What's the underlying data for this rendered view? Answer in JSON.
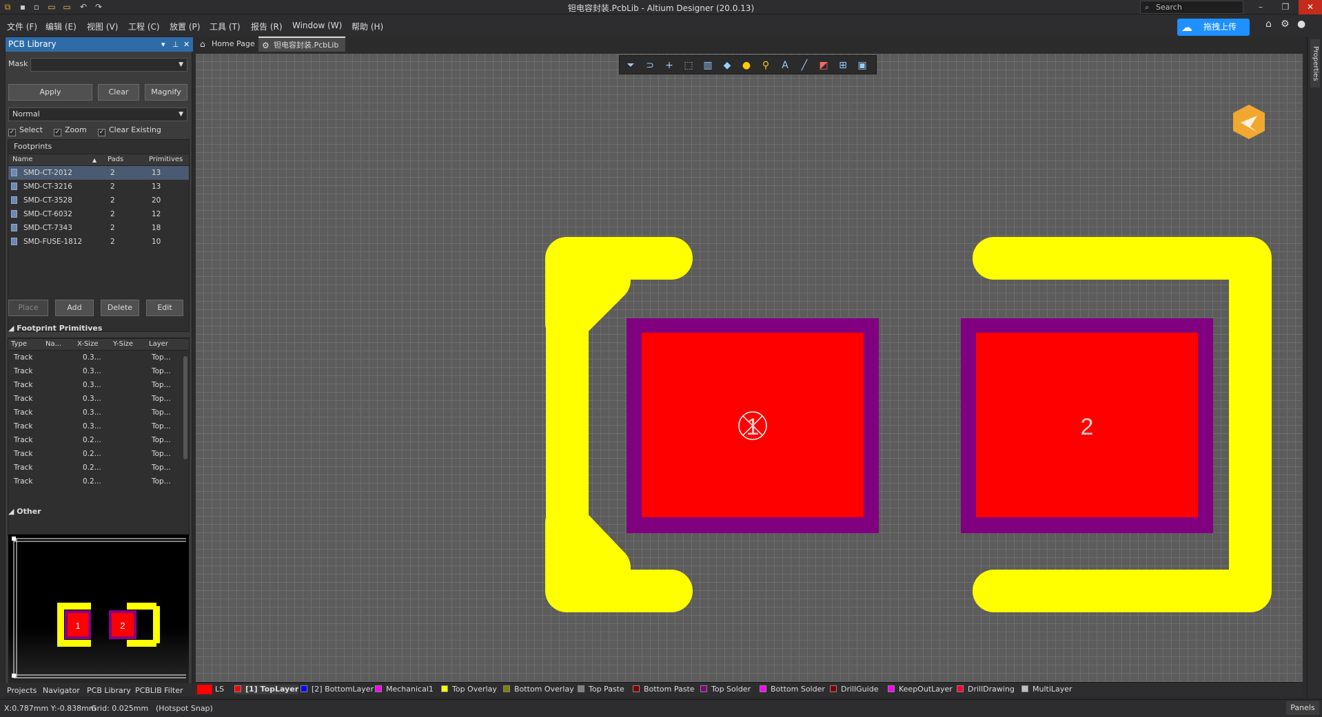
{
  "window": {
    "title": "钽电容封装.PcbLib - Altium Designer (20.0.13)",
    "search_placeholder": "Search",
    "minimize": "–",
    "restore": "❐",
    "close": "✕"
  },
  "menu": [
    "文件 (F)",
    "编辑 (E)",
    "视图 (V)",
    "工程 (C)",
    "放置 (P)",
    "工具 (T)",
    "报告 (R)",
    "Window (W)",
    "帮助 (H)"
  ],
  "upload": {
    "label": "拖拽上传"
  },
  "panel": {
    "title": "PCB Library",
    "mask_label": "Mask",
    "mask_value": "",
    "buttons": {
      "apply": "Apply",
      "clear": "Clear",
      "magnify": "Magnify"
    },
    "mode": "Normal",
    "checks": {
      "select": "Select",
      "zoom": "Zoom",
      "clear_existing": "Clear Existing"
    }
  },
  "footprints": {
    "title": "Footprints",
    "columns": [
      "Name",
      "Pads",
      "Primitives"
    ],
    "rows": [
      {
        "name": "SMD-CT-2012",
        "pads": "2",
        "prims": "13"
      },
      {
        "name": "SMD-CT-3216",
        "pads": "2",
        "prims": "13"
      },
      {
        "name": "SMD-CT-3528",
        "pads": "2",
        "prims": "20"
      },
      {
        "name": "SMD-CT-6032",
        "pads": "2",
        "prims": "12"
      },
      {
        "name": "SMD-CT-7343",
        "pads": "2",
        "prims": "18"
      },
      {
        "name": "SMD-FUSE-1812",
        "pads": "2",
        "prims": "10"
      }
    ],
    "buttons": {
      "place": "Place",
      "add": "Add",
      "delete": "Delete",
      "edit": "Edit"
    }
  },
  "primitives": {
    "title": "Footprint Primitives",
    "columns": [
      "Type",
      "Na...",
      "X-Size",
      "Y-Size",
      "Layer"
    ],
    "rows": [
      {
        "type": "Track",
        "x": "0.3...",
        "layer": "Top..."
      },
      {
        "type": "Track",
        "x": "0.3...",
        "layer": "Top..."
      },
      {
        "type": "Track",
        "x": "0.3...",
        "layer": "Top..."
      },
      {
        "type": "Track",
        "x": "0.3...",
        "layer": "Top..."
      },
      {
        "type": "Track",
        "x": "0.3...",
        "layer": "Top..."
      },
      {
        "type": "Track",
        "x": "0.3...",
        "layer": "Top..."
      },
      {
        "type": "Track",
        "x": "0.2...",
        "layer": "Top..."
      },
      {
        "type": "Track",
        "x": "0.2...",
        "layer": "Top..."
      },
      {
        "type": "Track",
        "x": "0.2...",
        "layer": "Top..."
      },
      {
        "type": "Track",
        "x": "0.2...",
        "layer": "Top..."
      }
    ]
  },
  "other": {
    "title": "Other",
    "pad1": "1",
    "pad2": "2"
  },
  "tabs": [
    "Home Page",
    "钽电容封装.PcbLib"
  ],
  "pads": {
    "pad1": "1",
    "pad2": "2"
  },
  "right_panel": "Properties",
  "layers": [
    {
      "name": "LS",
      "color": "#ff0000"
    },
    {
      "name": "[1] TopLayer",
      "color": "#ff0000"
    },
    {
      "name": "[2] BottomLayer",
      "color": "#0000ff"
    },
    {
      "name": "Mechanical1",
      "color": "#ff00ff"
    },
    {
      "name": "Top Overlay",
      "color": "#ffff00"
    },
    {
      "name": "Bottom Overlay",
      "color": "#808000"
    },
    {
      "name": "Top Paste",
      "color": "#808080"
    },
    {
      "name": "Bottom Paste",
      "color": "#800000"
    },
    {
      "name": "Top Solder",
      "color": "#800080"
    },
    {
      "name": "Bottom Solder",
      "color": "#ff00ff"
    },
    {
      "name": "DrillGuide",
      "color": "#800000"
    },
    {
      "name": "KeepOutLayer",
      "color": "#ff00ff"
    },
    {
      "name": "DrillDrawing",
      "color": "#ff002a"
    },
    {
      "name": "MultiLayer",
      "color": "#c0c0c0"
    }
  ],
  "bottom_tabs": [
    "Projects",
    "Navigator",
    "PCB Library",
    "PCBLIB Filter"
  ],
  "status": {
    "coords": "X:0.787mm Y:-0.838mm",
    "grid": "Grid: 0.025mm",
    "snap": "(Hotspot Snap)",
    "panels": "Panels"
  }
}
